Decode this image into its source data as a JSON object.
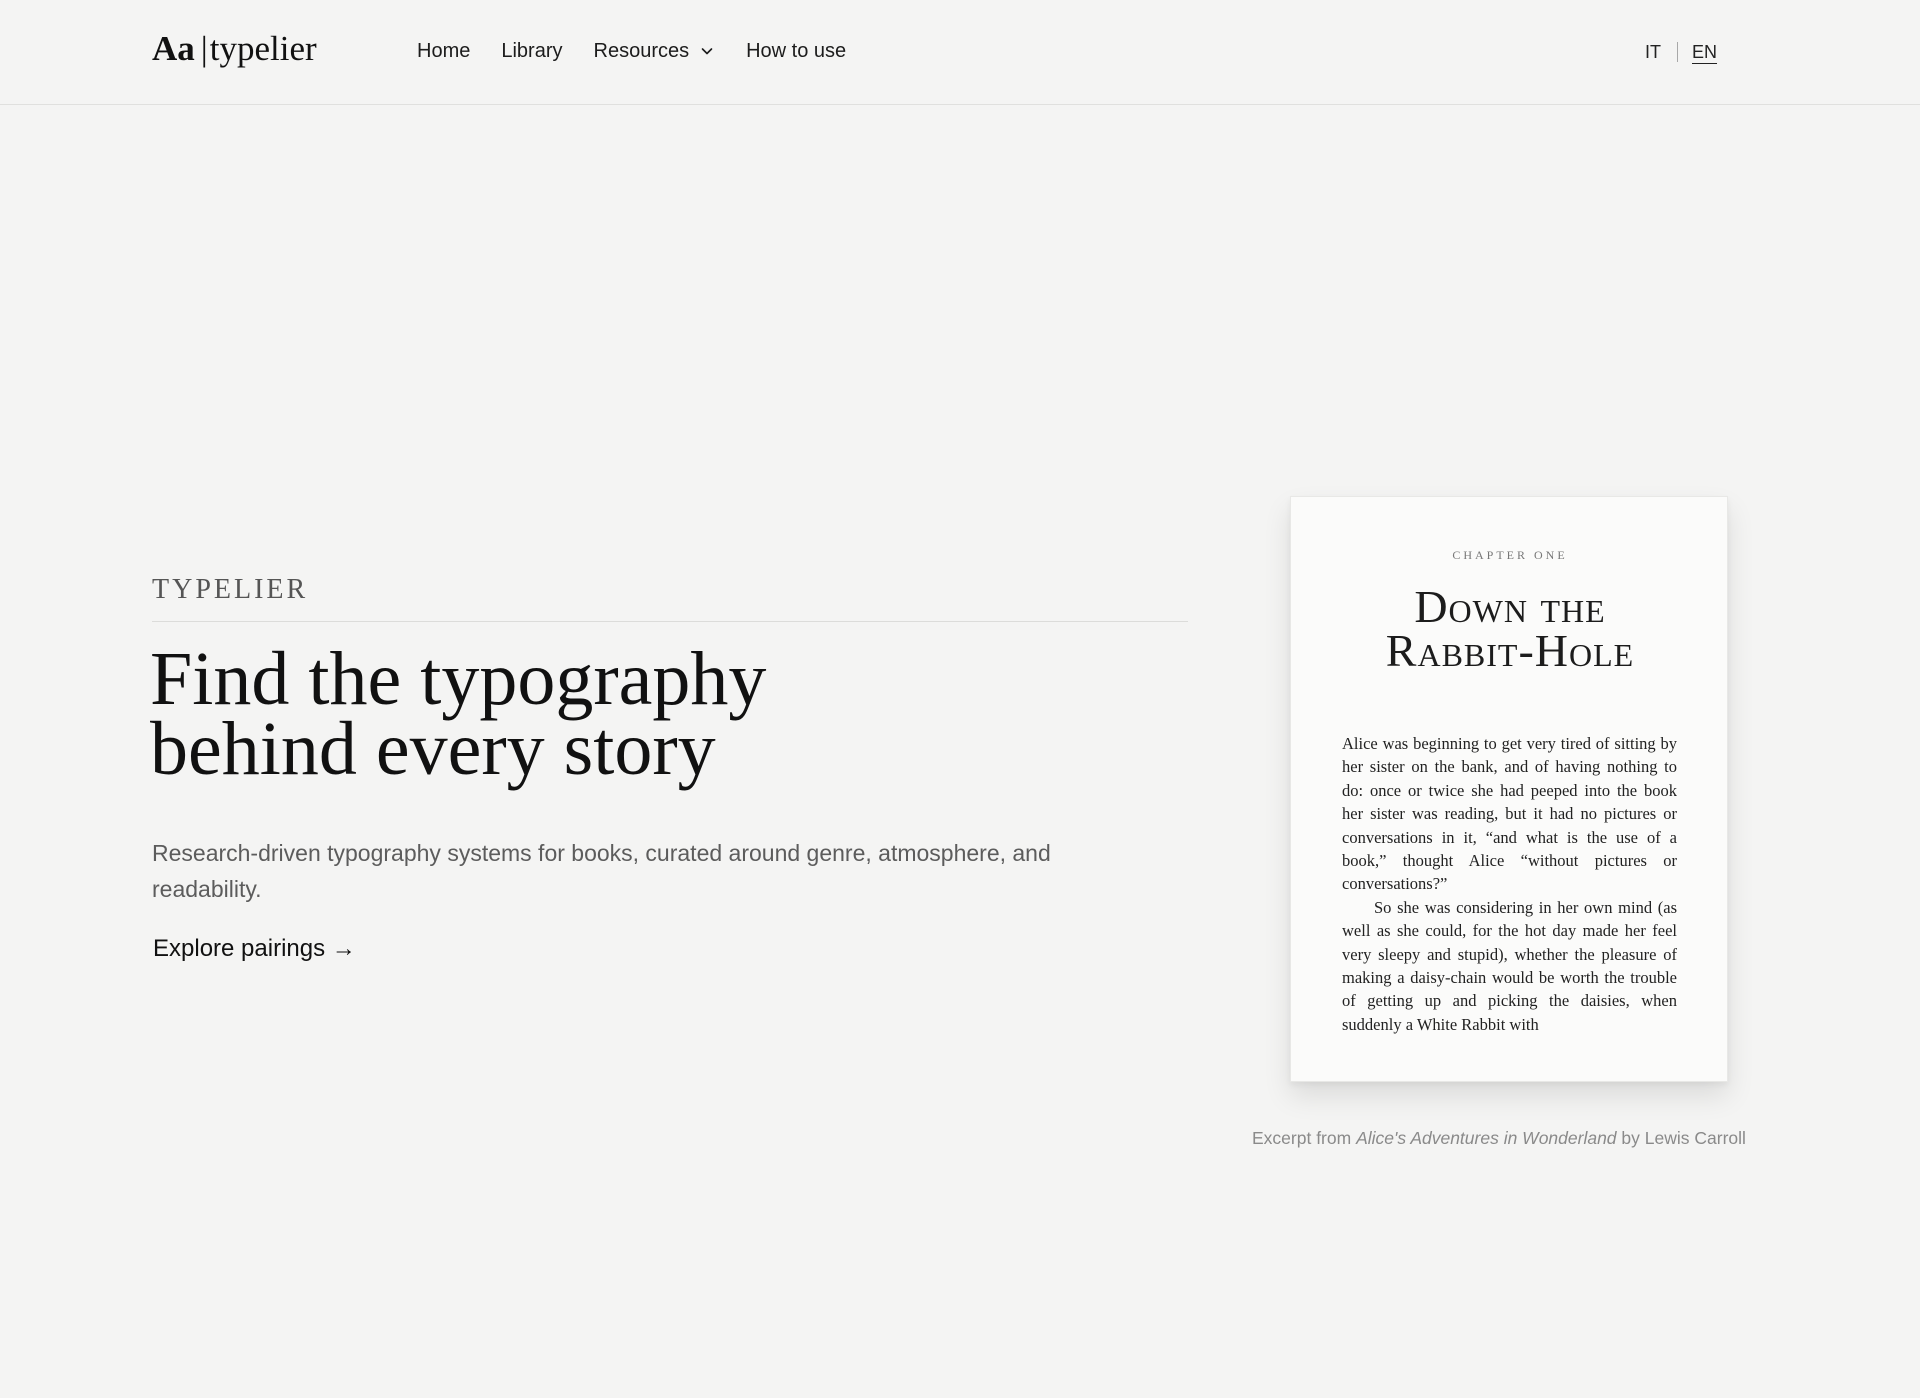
{
  "header": {
    "logo": {
      "mark": "Aa",
      "separator": "|",
      "name": "typelier"
    },
    "nav": [
      {
        "label": "Home"
      },
      {
        "label": "Library"
      },
      {
        "label": "Resources",
        "icon": "chevron-down-icon"
      },
      {
        "label": "How to use"
      }
    ],
    "languages": [
      {
        "label": "IT",
        "active": false
      },
      {
        "label": "EN",
        "active": true
      }
    ]
  },
  "hero": {
    "eyebrow": "TYPELIER",
    "headline_line1": "Find the typography",
    "headline_line2": "behind every story",
    "subtext": "Research-driven typography systems for books, curated around genre, atmosphere, and readability.",
    "cta": "Explore pairings →"
  },
  "book_preview": {
    "chapter_label": "CHAPTER ONE",
    "title_line1": "Down the",
    "title_line2": "Rabbit-Hole",
    "paragraph1": "Alice was beginning to get very tired of sitting by her sister on the bank, and of having noth­ing to do: once or twice she had peeped into the book her sister was reading, but it had no pictures or conversations in it, “and what is the use of a book,” thought Alice “without pictures or conversations?”",
    "paragraph2": "So she was considering in her own mind (as well as she could, for the hot day made her feel very sleepy and stupid), whether the plea­sure of making a daisy-chain would be worth the trouble of getting up and picking the daisies, when suddenly a White Rabbit with",
    "caption_prefix": "Excerpt from",
    "caption_title": "Alice's Adventures in Wonderland",
    "caption_suffix": "by Lewis Carroll"
  },
  "colors": {
    "background": "#f4f4f3",
    "text": "#1a1a1a",
    "muted": "#5c5c5c",
    "caption": "#8a8a8a",
    "card": "#fbfbfa"
  }
}
